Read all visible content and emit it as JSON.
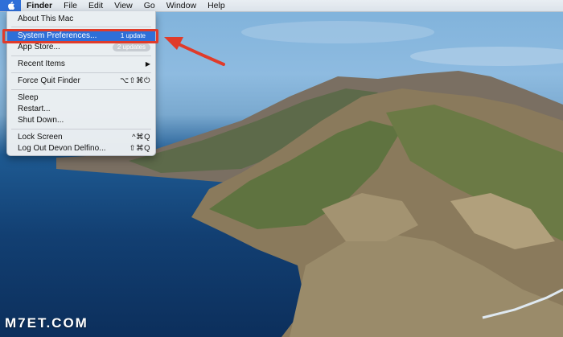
{
  "menubar": {
    "apple_icon": "apple-logo",
    "items": [
      "Finder",
      "File",
      "Edit",
      "View",
      "Go",
      "Window",
      "Help"
    ]
  },
  "apple_menu": {
    "about": "About This Mac",
    "system_prefs": {
      "label": "System Preferences...",
      "badge": "1 update"
    },
    "app_store": {
      "label": "App Store...",
      "badge": "2 updates"
    },
    "recent_items": "Recent Items",
    "force_quit": {
      "label": "Force Quit Finder",
      "shortcut": "⌥⇧⌘⏻"
    },
    "sleep": "Sleep",
    "restart": "Restart...",
    "shutdown": "Shut Down...",
    "lock": {
      "label": "Lock Screen",
      "shortcut": "^⌘Q"
    },
    "logout": {
      "label": "Log Out Devon Delfino...",
      "shortcut": "⇧⌘Q"
    }
  },
  "annotation": {
    "color": "#e03b2a"
  },
  "watermark": "M7ET.COM"
}
